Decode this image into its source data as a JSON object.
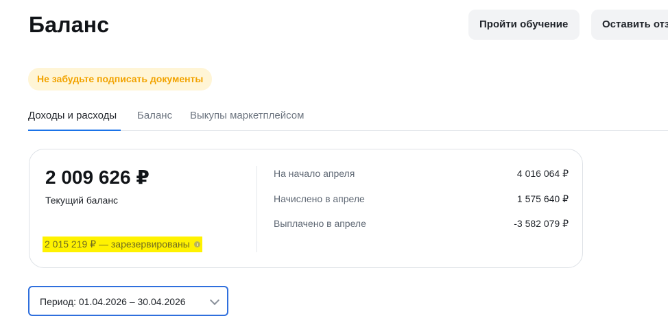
{
  "page": {
    "title": "Баланс"
  },
  "header_actions": {
    "training_label": "Пройти обучение",
    "feedback_label": "Оставить отз"
  },
  "notice": {
    "text": "Не забудьте подписать документы"
  },
  "tabs": [
    {
      "label": "Доходы и расходы",
      "active": true
    },
    {
      "label": "Баланс",
      "active": false
    },
    {
      "label": "Выкупы маркетплейсом",
      "active": false
    }
  ],
  "balance_card": {
    "current_amount": "2 009 626 ₽",
    "current_label": "Текущий баланс",
    "reserved_text": "2 015 219 ₽ — зарезервированы",
    "stats": [
      {
        "label": "На начало апреля",
        "value": "4 016 064 ₽"
      },
      {
        "label": "Начислено в апреле",
        "value": "1 575 640 ₽"
      },
      {
        "label": "Выплачено в апреле",
        "value": "-3 582 079 ₽"
      }
    ]
  },
  "period_filter": {
    "label": "Период: 01.04.2026 – 30.04.2026"
  },
  "colors": {
    "active_tab_underline": "#1a73e8",
    "notice_background": "#fff5d6",
    "notice_text": "#f2a300",
    "highlight": "#fff200",
    "period_border": "#2f6fdd"
  }
}
